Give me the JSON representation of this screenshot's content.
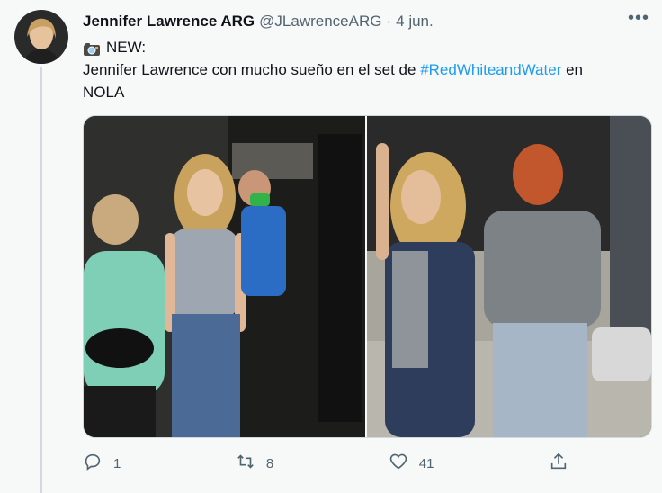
{
  "tweet": {
    "author_name": "Jennifer Lawrence ARG",
    "author_handle": "@JLawrenceARG",
    "separator": "·",
    "date": "4 jun.",
    "line1": "NEW:",
    "line2_prefix": "Jennifer Lawrence con mucho sueño en el set de ",
    "hashtag": "#RedWhiteandWater",
    "line2_suffix": " en",
    "line3": "NOLA",
    "icons": {
      "camera": "camera-icon",
      "more": "more-icon",
      "reply": "reply-icon",
      "retweet": "retweet-icon",
      "like": "like-icon",
      "share": "share-icon"
    },
    "stats": {
      "replies": "1",
      "retweets": "8",
      "likes": "41"
    },
    "colors": {
      "link": "#1d9bf0",
      "muted": "#536471",
      "background": "#f7f9f9"
    }
  }
}
